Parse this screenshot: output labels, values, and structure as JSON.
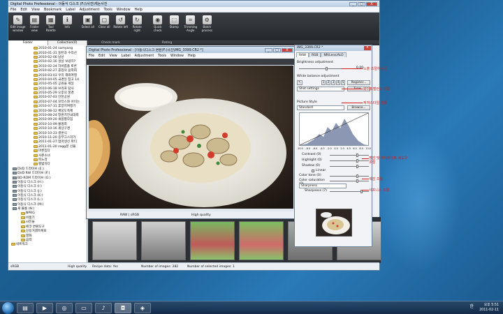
{
  "window": {
    "title": "Digital Photo Professional - 이동식 디스크 (F:)\\사진\\캐논사진",
    "min": "_",
    "max": "□",
    "close": "X"
  },
  "menu": [
    "File",
    "Edit",
    "View",
    "Bookmark",
    "Label",
    "Adjustment",
    "Tools",
    "Window",
    "Help"
  ],
  "toolbar": [
    {
      "label": "Edit image\nwindow",
      "icon": "✎"
    },
    {
      "label": "Folder\nview",
      "icon": "▤"
    },
    {
      "label": "Tool\nPalette",
      "icon": "▦"
    },
    {
      "label": "Info",
      "icon": "ℹ"
    },
    {
      "label": "Select all",
      "icon": "▣"
    },
    {
      "label": "Clear all",
      "icon": "▢"
    },
    {
      "label": "Rotate left",
      "icon": "↺"
    },
    {
      "label": "Rotate right",
      "icon": "↻"
    },
    {
      "label": "Quick\ncheck",
      "icon": "◉"
    },
    {
      "label": "Stamp",
      "icon": "⬚"
    },
    {
      "label": "Trimming\nAngle",
      "icon": "⌗"
    },
    {
      "label": "Batch\nprocess",
      "icon": "⚙"
    }
  ],
  "subbar": {
    "tabs": [
      "Folder",
      "Collection(0)"
    ],
    "check_mark": "Check mark",
    "rating": "Rating"
  },
  "tree": [
    "2010-01-24 samyang",
    "2010-01-31 동탄과 수리산",
    "2010-02-06 남산",
    "2010-02-16 설날 보냈지?",
    "2010-02-24 하바롭플 토론",
    "2010-02-27 휴업의 음악회",
    "2010-03-03 우리 해외여행",
    "2010-04-05 국경일 참고 14",
    "2010-05-05 공원을 세일",
    "2010-06-18 브리프 탐사",
    "2010-05-29 오후의 풍경",
    "2010-07-03 인천공원",
    "2010-07-04 모티스와 아이는",
    "2010-07-31 휴양지여행기",
    "2010-08-12 체당도축제",
    "2010-08-24 창원치전국대회",
    "2010-09-20 새봄별모임",
    "2010-10-09 불멍회",
    "2010-10-16 세상구경",
    "2010-10-23 결혼식",
    "2010-11-20 중부그스리가",
    "2011-01-27 엄마생신 파티",
    "2011-01-20 zagg분 선물"
  ],
  "tree_sub": [
    "마른입다",
    "사촌소녀",
    "파노라",
    "평범하다"
  ],
  "drives": [
    "DVD 드라이브 (E:)",
    "DVD RW 드라이브 (F:)",
    "BD-ROM 드라이브 (G:)",
    "이동식 디스크 (H:)",
    "이동식 디스크 (I:)",
    "이동식 디스크 (J:)",
    "이동식 디스크 (K:)",
    "이동식 디스크 (L:)",
    "이동식 디스크 (M:)"
  ],
  "tree_bottom": [
    "새 볼륨 (N:)",
    "NPKG",
    "비품기",
    "사진들",
    "에코 변환도구",
    "신용거래목록표",
    "영화",
    "음악",
    "네트워크"
  ],
  "status": {
    "profile": "sRGB",
    "quality": "High quality",
    "recipe": "Recipe data: Yes",
    "images": "Number of images: 282",
    "selected": "Number of selected images: 1"
  },
  "viewer": {
    "title": "Digital Photo Professional - [이동식디스크 변환(F:)사진\\IMG_3399.CR2 *]",
    "menu": [
      "File",
      "Edit",
      "View",
      "Label",
      "Adjustment",
      "Tools",
      "Window",
      "Help"
    ],
    "status_left": "RAW | sRGB",
    "status_right": "High quality"
  },
  "tool_palette": {
    "title": "IMG_3399.CR2 *",
    "tabs": [
      "RAW",
      "RGB",
      "NR/Lens/ALO"
    ],
    "brightness_label": "Brightness adjustment",
    "brightness_value": "0.00",
    "wb_label": "White balance adjustment",
    "wb_presets": [
      "1",
      "2",
      "3",
      "4",
      "5"
    ],
    "register": "Register...",
    "shot_settings": "Shot settings",
    "tune": "Tune...",
    "picture_style_label": "Picture Style",
    "picture_style": "Standard",
    "browse": "Browse...",
    "hist_ticks": [
      "-10.0",
      "-8.0",
      "-6.0",
      "-4.0",
      "-2.0",
      "0.0",
      "2.0",
      "4.0",
      "6.0",
      "8.0",
      "10.0"
    ],
    "contrast": "Contrast (0)",
    "highlight": "Highlight (0)",
    "shadow": "Shadow (0)",
    "linear": "Linear",
    "color_tone": "Color tone (0)",
    "color_saturation": "Color saturation (0)",
    "sharpness_mode": "Sharpness",
    "sharpness": "Sharpness (7)"
  },
  "annotations": [
    "노출 조절하는곳",
    "화이트밸런스 조절",
    "픽쳐스타일 변경",
    "명암 및 하이라이트 섀도우 조절",
    "색감 조절",
    "샤프니스 조절"
  ],
  "taskbar": {
    "items": [
      {
        "icon": "folder-icon",
        "glyph": "▤"
      },
      {
        "icon": "media-icon",
        "glyph": "▶"
      },
      {
        "icon": "chrome-icon",
        "glyph": "◎"
      },
      {
        "icon": "window-icon",
        "glyph": "▭"
      },
      {
        "icon": "itunes-icon",
        "glyph": "♪"
      },
      {
        "icon": "camera-icon",
        "glyph": "◘"
      },
      {
        "icon": "dpp-icon",
        "glyph": "◈"
      }
    ],
    "lang": "한",
    "time": "오후 5:51",
    "date": "2011-02-11"
  },
  "colors": {
    "annotation": "#d21a1a",
    "toolbar": "#2b2e32",
    "desktop": "#1f6aa0"
  }
}
